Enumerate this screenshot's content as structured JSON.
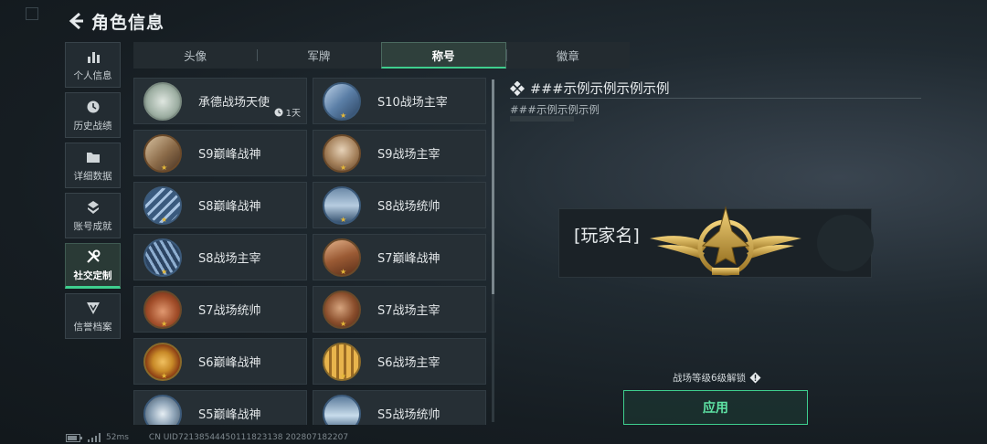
{
  "header": {
    "title": "角色信息"
  },
  "nav": {
    "items": [
      {
        "label": "个人信息",
        "icon": "bar-chart-icon",
        "active": false
      },
      {
        "label": "历史战绩",
        "icon": "clock-icon",
        "active": false
      },
      {
        "label": "详细数据",
        "icon": "folder-icon",
        "active": false
      },
      {
        "label": "账号成就",
        "icon": "achievement-icon",
        "active": false
      },
      {
        "label": "社交定制",
        "icon": "tools-icon",
        "active": true
      },
      {
        "label": "信誉档案",
        "icon": "shield-icon",
        "active": false
      }
    ]
  },
  "tabs": [
    {
      "label": "头像",
      "active": false
    },
    {
      "label": "军牌",
      "active": false
    },
    {
      "label": "称号",
      "active": true
    },
    {
      "label": "徽章",
      "active": false
    }
  ],
  "titles": [
    {
      "label": "承德战场天使",
      "timer": "1天",
      "badge": "angel-badge"
    },
    {
      "label": "S10战场主宰",
      "badge": "building-badge"
    },
    {
      "label": "S9巅峰战神",
      "badge": "ruins-badge"
    },
    {
      "label": "S9战场主宰",
      "badge": "explosion-badge"
    },
    {
      "label": "S8巅峰战神",
      "badge": "stripes-badge"
    },
    {
      "label": "S8战场统帅",
      "badge": "tank-badge"
    },
    {
      "label": "S8战场主宰",
      "badge": "tower-badge"
    },
    {
      "label": "S7巅峰战神",
      "badge": "rifle-badge"
    },
    {
      "label": "S7战场统帅",
      "badge": "tank2-badge"
    },
    {
      "label": "S7战场主宰",
      "badge": "soldier-badge"
    },
    {
      "label": "S6巅峰战神",
      "badge": "t-shield-badge"
    },
    {
      "label": "S6战场主宰",
      "badge": "ammo-badge"
    },
    {
      "label": "S5巅峰战神",
      "badge": "gasmask-badge"
    },
    {
      "label": "S5战场统帅",
      "badge": "boat-badge"
    }
  ],
  "detail": {
    "title": "###示例示例示例示例",
    "subtitle": "###示例示例示例",
    "player_name": "[玩家名]",
    "unlock_hint": "战场等级6级解锁",
    "apply_label": "应用"
  },
  "footer": {
    "ping": "52ms",
    "uid": "CN UID721385444501118231​38 202807182207"
  },
  "colors": {
    "accent": "#3ecf8e",
    "gold": "#d4a93a"
  }
}
